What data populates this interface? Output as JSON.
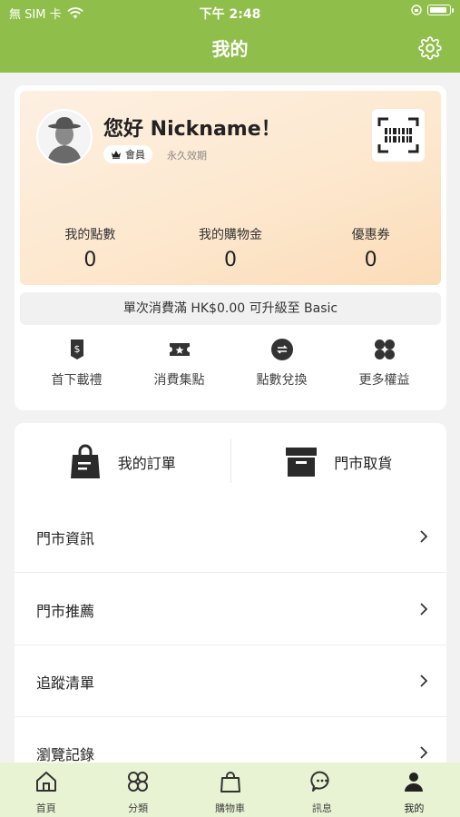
{
  "status_bar": {
    "carrier": "無 SIM 卡",
    "time": "下午 2:48"
  },
  "header": {
    "title": "我的"
  },
  "profile": {
    "greeting": "您好 Nickname！",
    "member_level": "會員",
    "validity": "永久效期"
  },
  "stats": [
    {
      "label": "我的點數",
      "value": "0"
    },
    {
      "label": "我的購物金",
      "value": "0"
    },
    {
      "label": "優惠券",
      "value": "0"
    }
  ],
  "upgrade_text": "單次消費滿 HK$0.00 可升級至 Basic",
  "benefits": [
    {
      "label": "首下載禮",
      "icon": "dollar-tag-icon"
    },
    {
      "label": "消費集點",
      "icon": "ticket-star-icon"
    },
    {
      "label": "點數兌換",
      "icon": "exchange-icon"
    },
    {
      "label": "更多權益",
      "icon": "grid-dots-icon"
    }
  ],
  "quick_actions": [
    {
      "label": "我的訂單",
      "icon": "shopping-bag-icon"
    },
    {
      "label": "門市取貨",
      "icon": "box-icon"
    }
  ],
  "menu": [
    {
      "label": "門市資訊"
    },
    {
      "label": "門市推薦"
    },
    {
      "label": "追蹤清單"
    },
    {
      "label": "瀏覽記錄"
    }
  ],
  "tabs": [
    {
      "label": "首頁",
      "icon": "home-icon"
    },
    {
      "label": "分類",
      "icon": "category-icon"
    },
    {
      "label": "購物車",
      "icon": "cart-bag-icon"
    },
    {
      "label": "訊息",
      "icon": "chat-icon"
    },
    {
      "label": "我的",
      "icon": "person-icon",
      "active": true
    }
  ],
  "colors": {
    "brand": "#8fbf4a",
    "tabbar_bg": "#e8f3d4",
    "hero_gradient_end": "#fbdcb8"
  }
}
